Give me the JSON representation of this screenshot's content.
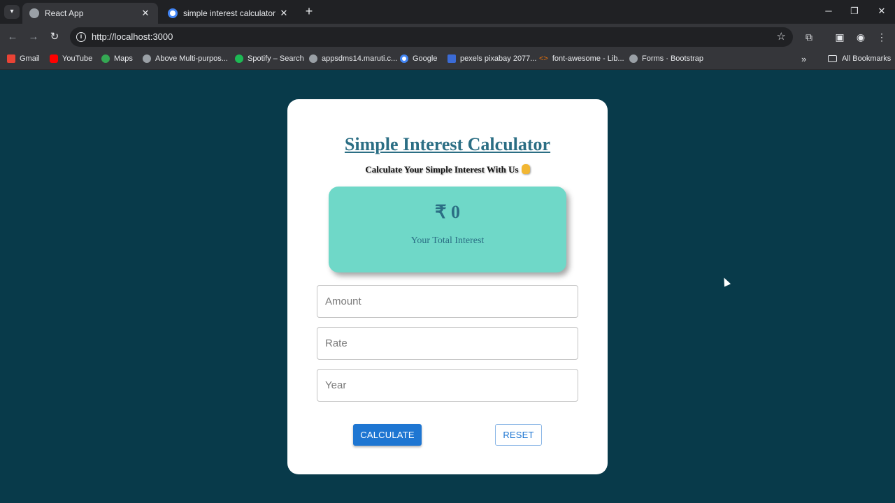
{
  "browser": {
    "tabs": [
      {
        "title": "React App",
        "active": true,
        "favicon": "globe-icon"
      },
      {
        "title": "simple interest calculator - Goo",
        "active": false,
        "favicon": "google-icon"
      }
    ],
    "url": "http://localhost:3000",
    "bookmarks": [
      {
        "label": "Gmail",
        "icon": "gmail-icon",
        "color": "#ea4335"
      },
      {
        "label": "YouTube",
        "icon": "youtube-icon",
        "color": "#ff0000"
      },
      {
        "label": "Maps",
        "icon": "maps-icon",
        "color": "#34a853"
      },
      {
        "label": "Above Multi-purpos...",
        "icon": "globe-icon",
        "color": "#9aa0a6"
      },
      {
        "label": "Spotify – Search",
        "icon": "spotify-icon",
        "color": "#1db954"
      },
      {
        "label": "appsdms14.maruti.c...",
        "icon": "globe-icon",
        "color": "#9aa0a6"
      },
      {
        "label": "Google",
        "icon": "google-icon",
        "color": "#4285f4"
      },
      {
        "label": "pexels pixabay 2077...",
        "icon": "pexels-icon",
        "color": "#3b6bd6"
      },
      {
        "label": "font-awesome - Lib...",
        "icon": "code-icon",
        "color": "#e8710a"
      },
      {
        "label": "Forms · Bootstrap",
        "icon": "globe-icon",
        "color": "#9aa0a6"
      }
    ],
    "all_bookmarks": "All Bookmarks"
  },
  "app": {
    "heading": "Simple Interest Calculator",
    "subheading": "Calculate Your Simple Interest With Us",
    "result_value": "₹ 0",
    "result_label": "Your Total Interest",
    "fields": [
      {
        "placeholder": "Amount",
        "value": ""
      },
      {
        "placeholder": "Rate",
        "value": ""
      },
      {
        "placeholder": "Year",
        "value": ""
      }
    ],
    "calculate_label": "CALCULATE",
    "reset_label": "RESET"
  },
  "colors": {
    "page_bg": "#083a4a",
    "accent": "#1e76d2",
    "result_bg": "#6fd8c8",
    "heading": "#2b6e84"
  }
}
